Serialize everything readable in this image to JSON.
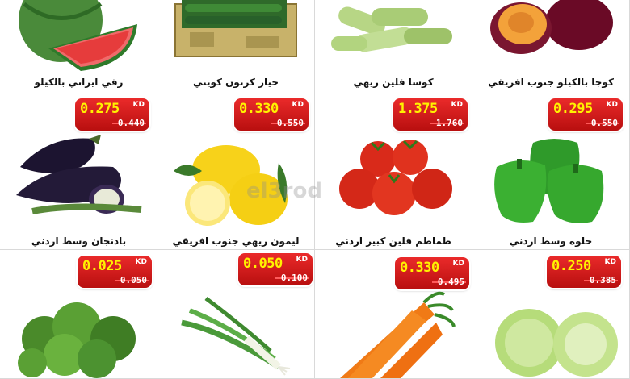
{
  "products": [
    {
      "name": "كوجا بالكيلو جنوب افريقي",
      "price": "",
      "old_price": "",
      "currency": ""
    },
    {
      "name": "كوسا فلين ريهي",
      "price": "",
      "old_price": "",
      "currency": ""
    },
    {
      "name": "خيار كرتون كويتي",
      "price": "",
      "old_price": "",
      "currency": ""
    },
    {
      "name": "رقي ايراني بالكيلو",
      "price": "",
      "old_price": "",
      "currency": ""
    },
    {
      "name": "حلوه وسط اردني",
      "price": "0.295",
      "old_price": "0.550",
      "currency": "KD"
    },
    {
      "name": "طماطم فلين كبير اردني",
      "price": "1.375",
      "old_price": "1.760",
      "currency": "KD"
    },
    {
      "name": "ليمون ريهي جنوب افريقي",
      "price": "0.330",
      "old_price": "0.550",
      "currency": "KD"
    },
    {
      "name": "باذنجان وسط اردني",
      "price": "0.275",
      "old_price": "0.440",
      "currency": "KD"
    },
    {
      "name": "",
      "price": "0.250",
      "old_price": "0.385",
      "currency": "KD"
    },
    {
      "name": "",
      "price": "0.330",
      "old_price": "0.495",
      "currency": "KD"
    },
    {
      "name": "",
      "price": "0.050",
      "old_price": "0.100",
      "currency": "KD"
    },
    {
      "name": "",
      "price": "0.025",
      "old_price": "0.050",
      "currency": "KD"
    }
  ],
  "watermark": "el3rod",
  "colors": {
    "badge": "#d01818",
    "price_text": "#fff200",
    "grid_line": "#d9d9d9"
  }
}
